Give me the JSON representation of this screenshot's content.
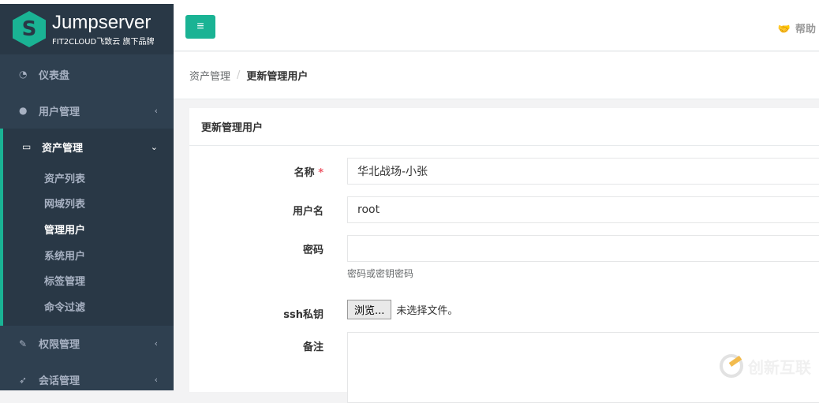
{
  "logo": {
    "title": "Jumpserver",
    "subtitle": "FIT2CLOUD飞致云 旗下品牌"
  },
  "sidebar": {
    "items": [
      {
        "label": "仪表盘",
        "icon": "dashboard-icon"
      },
      {
        "label": "用户管理",
        "icon": "users-icon"
      },
      {
        "label": "资产管理",
        "icon": "inbox-icon",
        "subitems": [
          "资产列表",
          "网域列表",
          "管理用户",
          "系统用户",
          "标签管理",
          "命令过滤"
        ],
        "current": "管理用户"
      },
      {
        "label": "权限管理",
        "icon": "edit-icon"
      },
      {
        "label": "会话管理",
        "icon": "rocket-icon"
      }
    ]
  },
  "header": {
    "menu_icon": "≡",
    "help": "帮助"
  },
  "breadcrumb": {
    "parent": "资产管理",
    "sep": "/",
    "current": "更新管理用户"
  },
  "panel": {
    "title": "更新管理用户"
  },
  "form": {
    "name_label": "名称",
    "required": "*",
    "name_value": "华北战场-小张",
    "username_label": "用户名",
    "username_value": "root",
    "password_label": "密码",
    "password_value": "",
    "password_hint": "密码或密钥密码",
    "key_label": "ssh私钥",
    "browse": "浏览...",
    "no_file": "未选择文件。",
    "comment_label": "备注"
  },
  "watermark": "创新互联",
  "colors": {
    "accent": "#1ab394",
    "sidebar": "#2f4050"
  }
}
